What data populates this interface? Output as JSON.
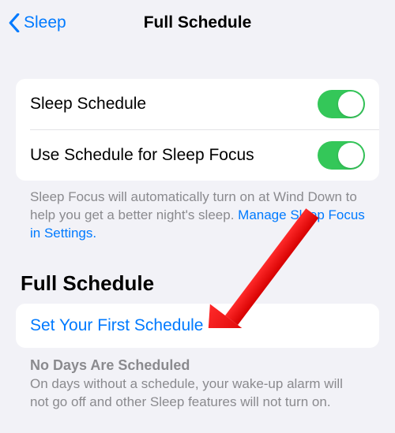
{
  "nav": {
    "back_label": "Sleep",
    "title": "Full Schedule"
  },
  "group1": {
    "row1_label": "Sleep Schedule",
    "row1_on": true,
    "row2_label": "Use Schedule for Sleep Focus",
    "row2_on": true,
    "footer_text": "Sleep Focus will automatically turn on at Wind Down to help you get a better night's sleep. ",
    "footer_link": "Manage Sleep Focus in Settings."
  },
  "section_header": "Full Schedule",
  "group2": {
    "action_label": "Set Your First Schedule"
  },
  "no_days": {
    "title": "No Days Are Scheduled",
    "body": "On days without a schedule, your wake-up alarm will not go off and other Sleep features will not turn on."
  },
  "colors": {
    "accent": "#007aff",
    "toggle_on": "#34c759",
    "arrow": "#ff0c17"
  }
}
